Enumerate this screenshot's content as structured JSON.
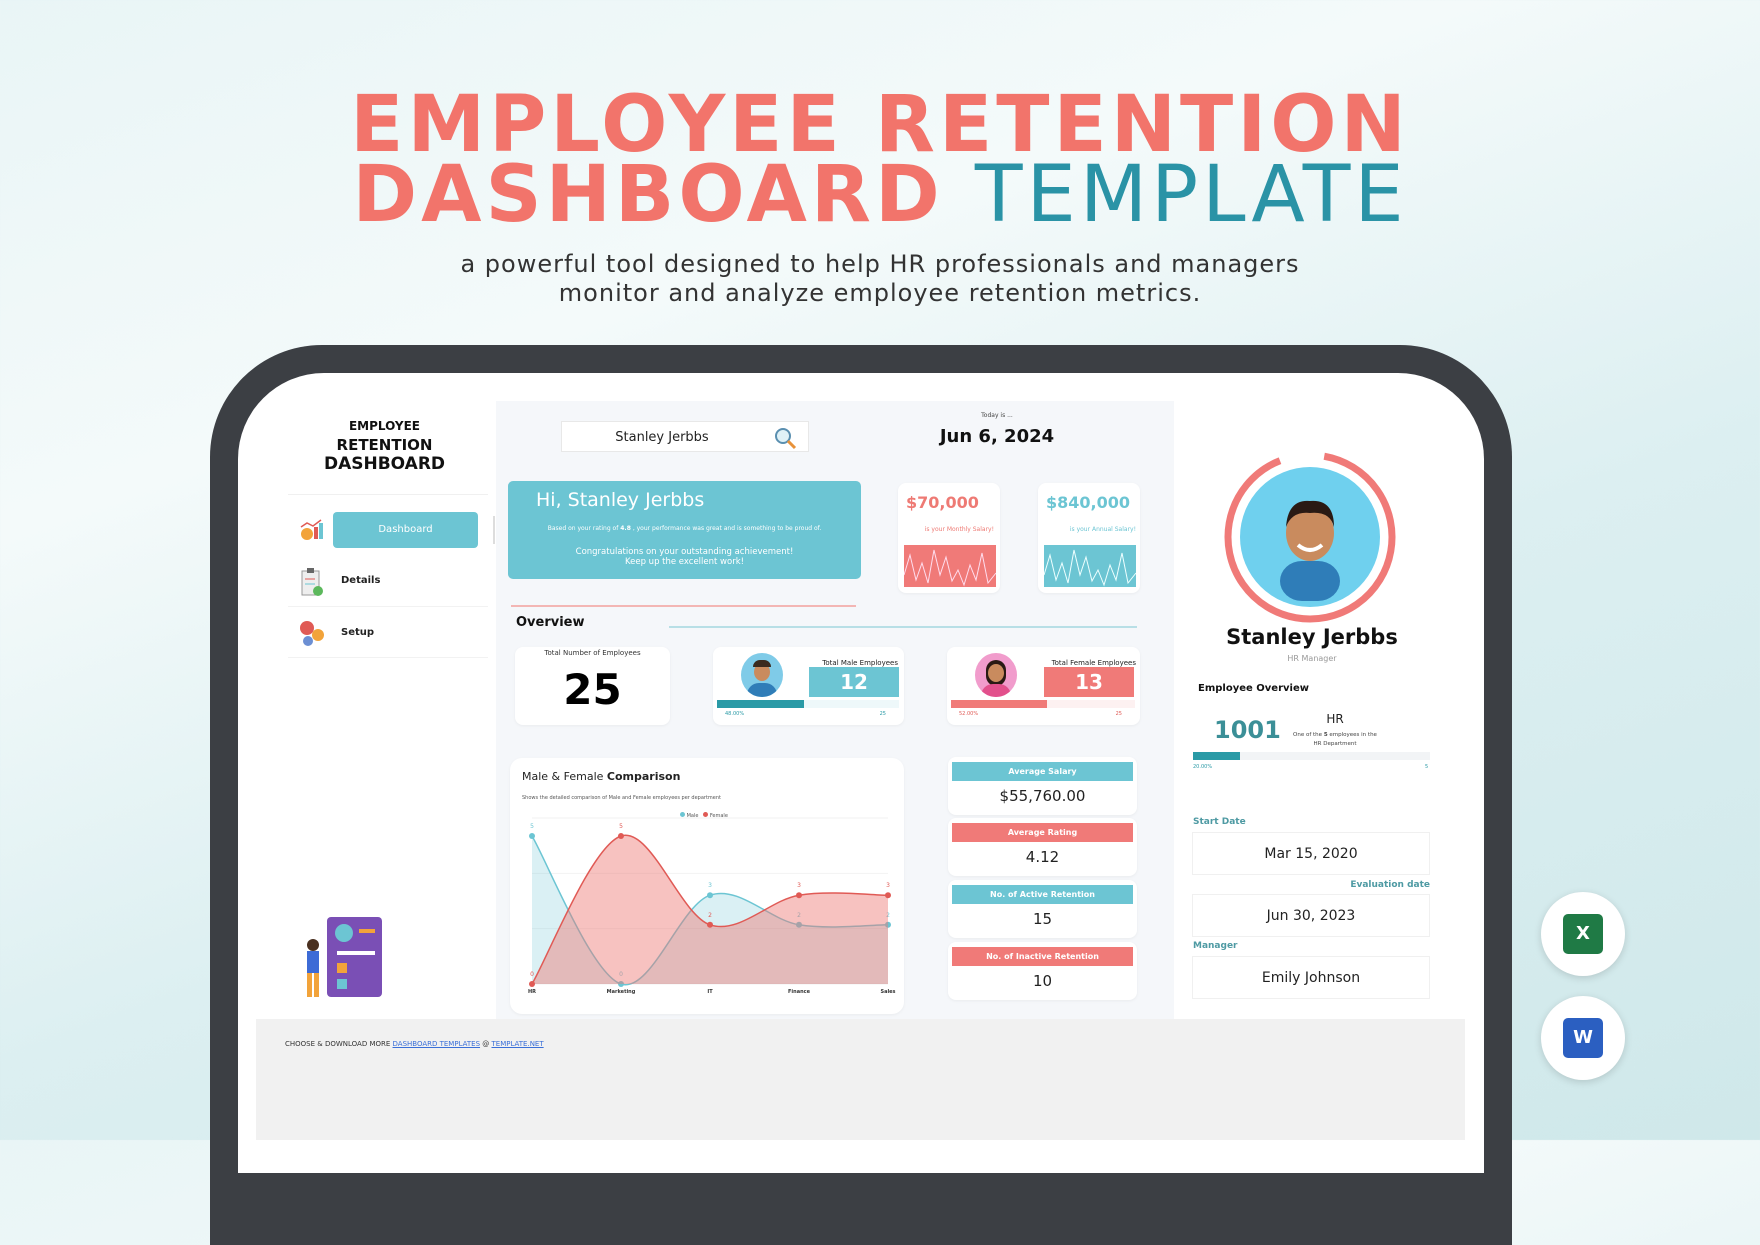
{
  "hero": {
    "title_line1": "EMPLOYEE RETENTION",
    "title_line2_bold": "DASHBOARD",
    "title_line2_light": "TEMPLATE",
    "subtitle_line1": "a powerful tool designed to help HR professionals and managers",
    "subtitle_line2": "monitor and analyze employee retention metrics."
  },
  "sidebar": {
    "title": [
      "EMPLOYEE",
      "RETENTION",
      "DASHBOARD"
    ],
    "items": [
      {
        "label": "Dashboard",
        "icon": "chart-icon",
        "active": true
      },
      {
        "label": "Details",
        "icon": "clipboard-icon"
      },
      {
        "label": "Setup",
        "icon": "gears-icon"
      }
    ]
  },
  "search": {
    "value": "Stanley Jerbbs",
    "icon": "search-icon"
  },
  "today": {
    "label": "Today is ...",
    "date": "Jun 6, 2024"
  },
  "greeting": {
    "title": "Hi, Stanley Jerbbs",
    "rating_prefix": "Based on your rating of",
    "rating": "4.8",
    "rating_suffix": ", your performance was great and is something to be proud of.",
    "congrats1": "Congratulations on your outstanding achievement!",
    "congrats2": "Keep up the excellent work!"
  },
  "salary": {
    "monthly": "$70,000",
    "monthly_label": "is your Monthly Salary!",
    "annual": "$840,000",
    "annual_label": "is your Annual Salary!"
  },
  "overview": {
    "title": "Overview",
    "total_label": "Total Number of Employees",
    "total": "25",
    "male_label": "Total Male Employees",
    "male": "12",
    "male_pct": "48.00%",
    "male_pct_value": 48,
    "male_of": "25",
    "female_label": "Total Female Employees",
    "female": "13",
    "female_pct": "52.00%",
    "female_pct_value": 52,
    "female_of": "25"
  },
  "stats": [
    {
      "label": "Average Salary",
      "value": "$55,760.00"
    },
    {
      "label": "Average Rating",
      "value": "4.12"
    },
    {
      "label": "No. of Active Retention",
      "value": "15"
    },
    {
      "label": "No. of Inactive Retention",
      "value": "10"
    }
  ],
  "chart_data": {
    "type": "area",
    "title_light": "Male & Female",
    "title_bold": "Comparison",
    "subtitle": "Shows the detailed comparison of Male and Female employees per department",
    "categories": [
      "HR",
      "Marketing",
      "IT",
      "Finance",
      "Sales"
    ],
    "series": [
      {
        "name": "Male",
        "values": [
          5,
          0,
          3,
          2,
          2
        ],
        "color": "#6cc5d3"
      },
      {
        "name": "Female",
        "values": [
          0,
          5,
          2,
          3,
          3
        ],
        "color": "#e05a55"
      }
    ],
    "ylim": [
      0,
      5
    ],
    "legend": "top-center",
    "grid": true
  },
  "profile": {
    "name": "Stanley Jerbbs",
    "role": "HR Manager",
    "overview_title": "Employee Overview",
    "id": "1001",
    "department": "HR",
    "dept_prefix": "One of the",
    "dept_count": "5",
    "dept_suffix": "employees in the",
    "dept_line2": "HR Department",
    "progress_pct": "20.00%",
    "progress_value": 20,
    "progress_total": "5",
    "start_label": "Start Date",
    "start": "Mar 15, 2020",
    "eval_label": "Evaluation date",
    "eval": "Jun 30, 2023",
    "manager_label": "Manager",
    "manager": "Emily Johnson"
  },
  "footer": {
    "prefix": "CHOOSE & DOWNLOAD MORE",
    "link1": "DASHBOARD TEMPLATES",
    "sep": "@",
    "link2": "TEMPLATE.NET"
  },
  "apps": {
    "excel": "X",
    "word": "W"
  },
  "colors": {
    "teal": "#6cc5d3",
    "coral": "#f07a78",
    "dark_teal": "#2a9aa6"
  }
}
